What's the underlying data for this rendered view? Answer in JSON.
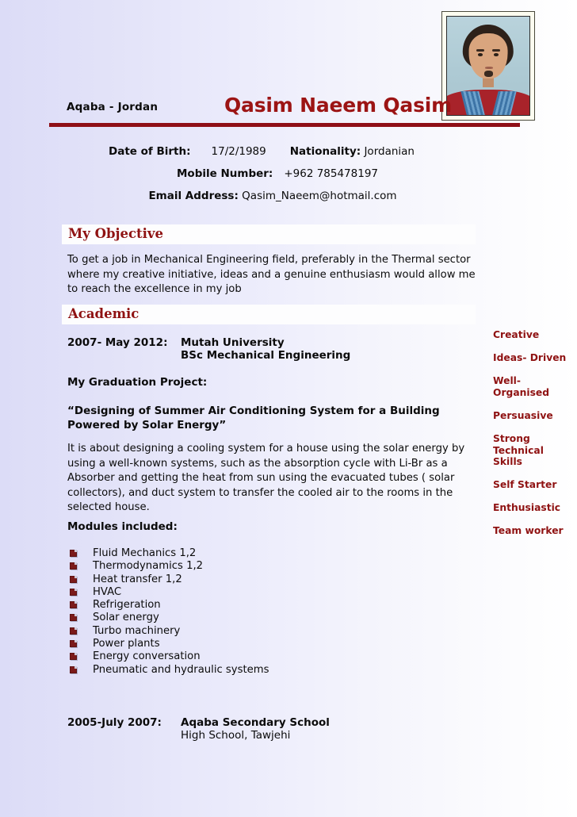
{
  "document": {
    "type": "curriculum-vitae",
    "accent_color": "#8f1212",
    "name_color": "#9c1414",
    "background": "lavender-to-white horizontal gradient"
  },
  "header": {
    "location": "Aqaba - Jordan",
    "name": "Qasim Naeem Qasim",
    "photo_alt": "portrait-photo"
  },
  "contact": {
    "dob_label": "Date of Birth:",
    "dob_value": "17/2/1989",
    "nationality_label": "Nationality:",
    "nationality_value": "Jordanian",
    "mobile_label": "Mobile Number:",
    "mobile_value": "+962 785478197",
    "email_label": "Email Address:",
    "email_value": "Qasim_Naeem@hotmail.com"
  },
  "sections": {
    "objective": {
      "heading": "My Objective",
      "text": "To get a job in Mechanical Engineering field, preferably in the Thermal sector where my creative initiative, ideas and a genuine enthusiasm would allow me to reach the excellence in my job"
    },
    "academic": {
      "heading": "Academic",
      "university": {
        "years": "2007- May 2012:",
        "institution": "Mutah University",
        "degree": "BSc Mechanical Engineering"
      },
      "graduation_project_label": "My Graduation Project:",
      "project_title": "“Designing of Summer Air Conditioning System for a Building Powered by Solar Energy”",
      "project_description": "It is about designing a cooling system for a house using the solar energy by using a well-known systems, such as the absorption cycle with Li-Br as a Absorber and getting the heat from sun using the evacuated tubes ( solar collectors), and duct system to transfer the cooled air to the rooms in the selected house.",
      "modules_label": "Modules included:",
      "modules": [
        "Fluid Mechanics 1,2",
        "Thermodynamics  1,2",
        "Heat transfer 1,2",
        "HVAC",
        "Refrigeration",
        "Solar energy",
        "Turbo machinery",
        "Power plants",
        "Energy conversation",
        "Pneumatic and hydraulic systems"
      ],
      "school": {
        "years": "2005-July 2007:",
        "institution": "Aqaba Secondary School",
        "detail": "High School, Tawjehi"
      }
    }
  },
  "skills": [
    "Creative",
    "Ideas- Driven",
    "Well-Organised",
    "Persuasive",
    "Strong Technical Skills",
    "Self Starter",
    "Enthusiastic",
    "Team worker"
  ]
}
